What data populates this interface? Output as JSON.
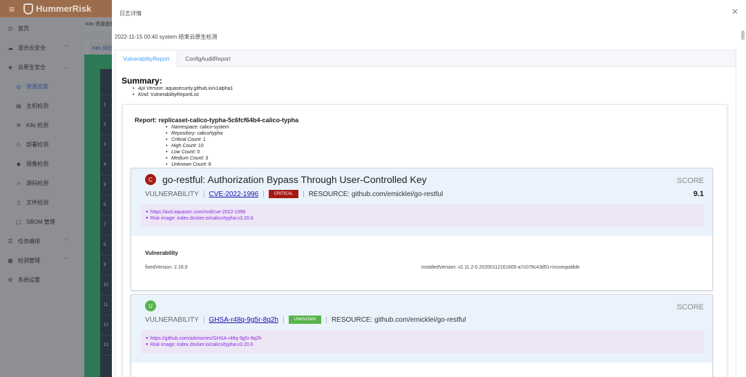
{
  "background": {
    "logo_text": "HummerRisk",
    "header_text": "K8s 资源态势",
    "tab_text": "K8s 风险",
    "nav": [
      {
        "label": "首页",
        "icon": "clock-icon",
        "level": 0
      },
      {
        "label": "混合云安全",
        "icon": "cloud-icon",
        "level": 0,
        "chevron": "down"
      },
      {
        "label": "云原生安全",
        "icon": "cube-icon",
        "level": 0,
        "chevron": "up"
      },
      {
        "label": "资源态势",
        "icon": "target-icon",
        "level": 1,
        "active": true
      },
      {
        "label": "主机检测",
        "icon": "server-icon",
        "level": 1
      },
      {
        "label": "K8s 检测",
        "icon": "k8s-icon",
        "level": 1
      },
      {
        "label": "部署检测",
        "icon": "deploy-icon",
        "level": 1
      },
      {
        "label": "镜像检测",
        "icon": "image-icon",
        "level": 1
      },
      {
        "label": "源码检测",
        "icon": "code-icon",
        "level": 1
      },
      {
        "label": "文件检测",
        "icon": "file-icon",
        "level": 1
      },
      {
        "label": "SBOM 管理",
        "icon": "sbom-icon",
        "level": 1
      },
      {
        "label": "任务编排",
        "icon": "list-icon",
        "level": 0,
        "chevron": "down"
      },
      {
        "label": "检测管理",
        "icon": "grid-icon",
        "level": 0,
        "chevron": "down"
      },
      {
        "label": "系统设置",
        "icon": "gear-icon",
        "level": 0
      }
    ],
    "row_numbers": [
      "1",
      "2",
      "3",
      "4",
      "5",
      "6",
      "7",
      "8",
      "9",
      "10",
      "11",
      "12",
      "13"
    ]
  },
  "drawer": {
    "title": "日志详情",
    "log_line": "2022-11-15 00:40 system 结束云原生检测",
    "tabs": [
      "VulnerabilityReport",
      "ConfigAuditReport"
    ],
    "active_tab": 0,
    "summary": {
      "title": "Summary:",
      "items": [
        {
          "key": "Api Version",
          "value": "aquasecurity.github.io/v1alpha1"
        },
        {
          "key": "Kind",
          "value": "VulnerabilityReportList"
        }
      ]
    },
    "report": {
      "name": "Report: replicaset-calico-typha-5c6fcf64b4-calico-typha",
      "items": [
        {
          "key": "Namespace",
          "value": "calico-system"
        },
        {
          "key": "Repository",
          "value": "calico/typha"
        },
        {
          "key": "Critical Count",
          "value": "1"
        },
        {
          "key": "High Count",
          "value": "10"
        },
        {
          "key": "Low Count",
          "value": "0"
        },
        {
          "key": "Medium Count",
          "value": "3"
        },
        {
          "key": "Unknown Count",
          "value": "8"
        }
      ]
    },
    "vulnerabilities": [
      {
        "severity_letter": "C",
        "severity_color": "#a51b14",
        "title": "go-restful: Authorization Bypass Through User-Controlled Key",
        "score_label": "SCORE",
        "score": "9.1",
        "vuln_label": "VULNERABILITY",
        "id": "CVE-2022-1996",
        "badge": "CRITICAL",
        "resource": "RESOURCE: github.com/emicklei/go-restful",
        "link": "https://avd.aquasec.com/nvd/cve-2022-1996",
        "risk_image": "Risk image: index.docker.io/calico/typha:v3.20.6",
        "body_title": "Vulnerability",
        "fixed_version": "fixedVersion:  2.16.0",
        "installed_version": "installedVersion:  v2.11.2-0.20200112161605-a7c079c43d51+incompatible"
      },
      {
        "severity_letter": "U",
        "severity_color": "#57b34a",
        "title": "",
        "score_label": "SCORE",
        "score": "",
        "vuln_label": "VULNERABILITY",
        "id": "GHSA-r48q-9g5r-8q2h",
        "badge": "UNKNOWN",
        "resource": "RESOURCE: github.com/emicklei/go-restful",
        "link": "https://github.com/advisories/GHSA-r48q-9g5r-8q2h",
        "risk_image": "Risk image: index.docker.io/calico/typha:v3.20.6"
      }
    ]
  }
}
